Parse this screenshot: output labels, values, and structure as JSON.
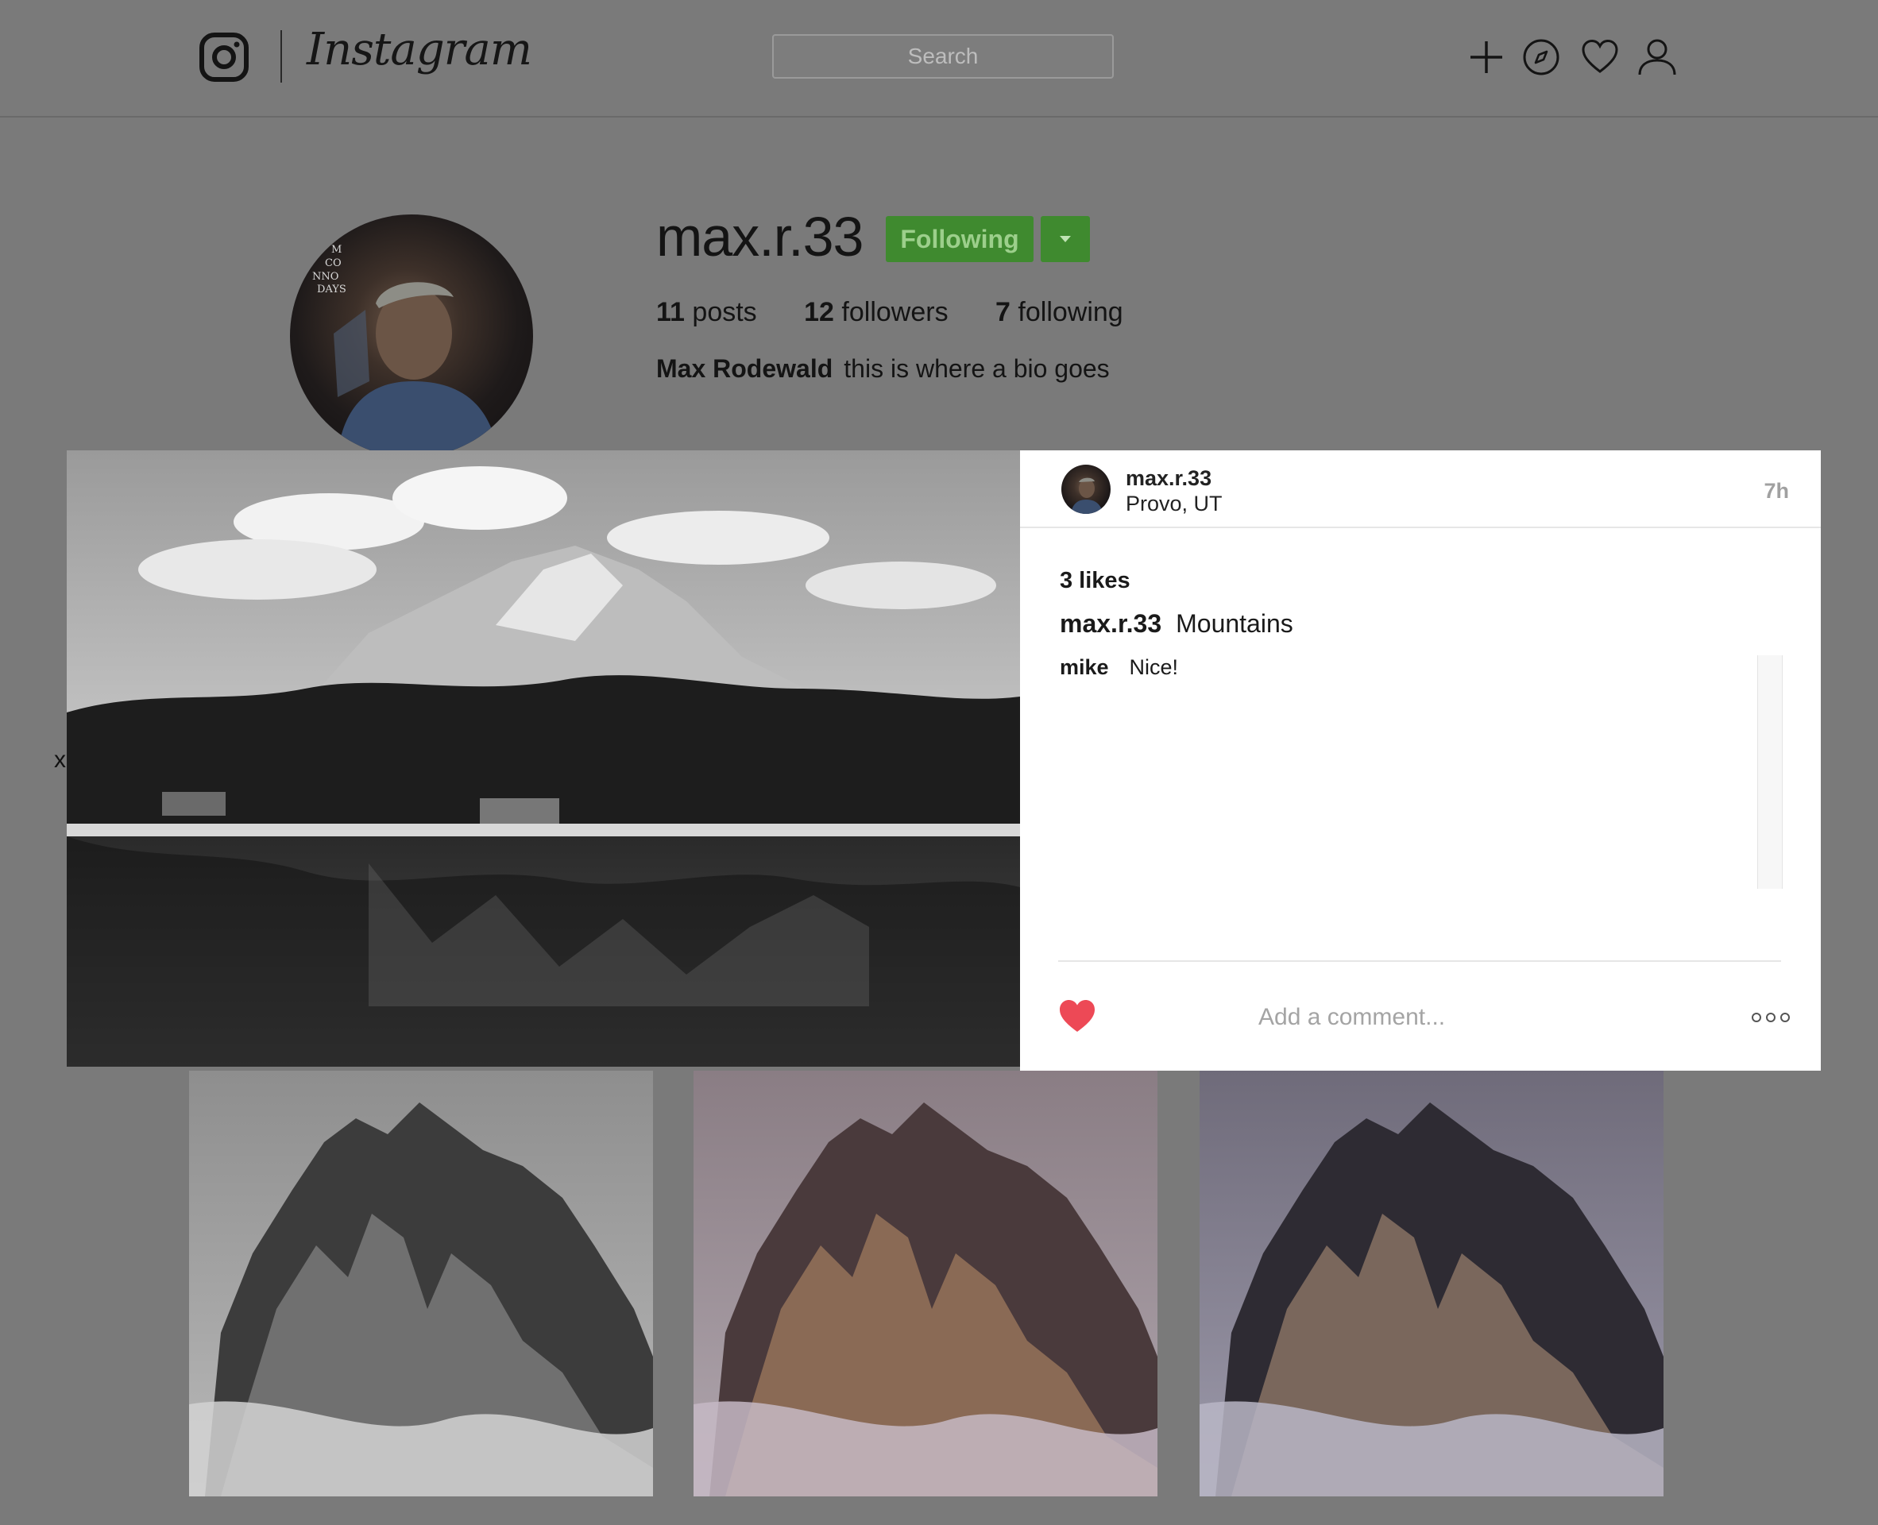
{
  "header": {
    "brand": "Instagram",
    "search_placeholder": "Search",
    "icons": [
      "instagram-glyph-icon",
      "plus-icon",
      "compass-icon",
      "heart-icon",
      "user-icon"
    ]
  },
  "profile": {
    "username": "max.r.33",
    "follow_label": "Following",
    "stats": [
      {
        "count": "11",
        "label": "posts"
      },
      {
        "count": "12",
        "label": "followers"
      },
      {
        "count": "7",
        "label": "following"
      }
    ],
    "full_name": "Max Rodewald",
    "bio": "this is where a bio goes"
  },
  "modal": {
    "close_label": "x",
    "user": "max.r.33",
    "location": "Provo, UT",
    "time": "7h",
    "likes": "3 likes",
    "caption_user": "max.r.33",
    "caption_text": "Mountains",
    "comments": [
      {
        "user": "mike",
        "text": "Nice!"
      }
    ],
    "comment_placeholder": "Add a comment...",
    "liked": true
  },
  "colors": {
    "following_button": "#3f8a2f",
    "like_heart": "#ed4956",
    "overlay": "#7a7a7a"
  }
}
